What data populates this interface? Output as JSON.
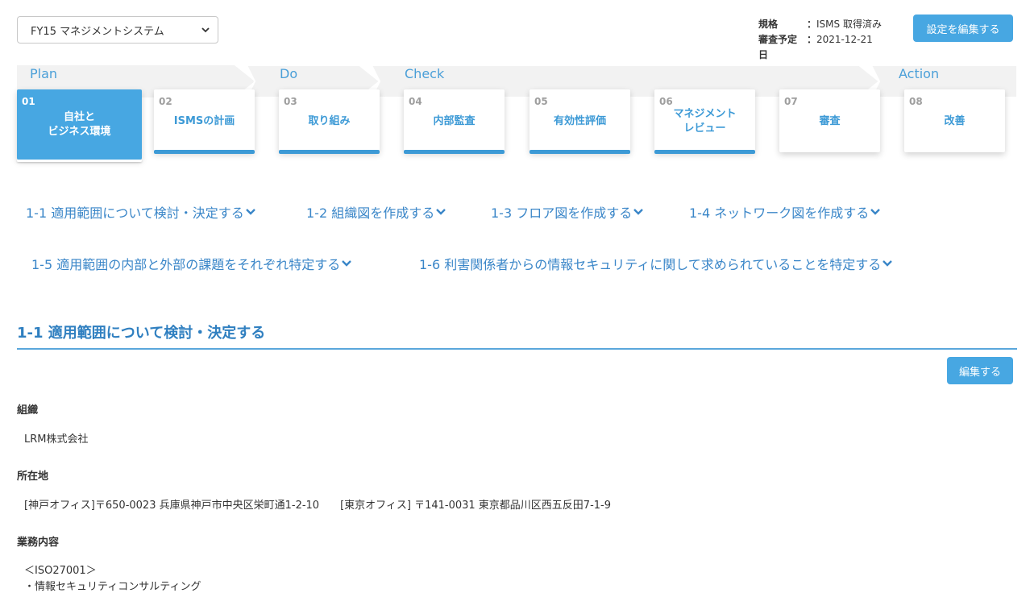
{
  "system_select": {
    "value": "FY15 マネジメントシステム"
  },
  "meta": {
    "standard_label": "規格",
    "standard_value": "ISMS 取得済み",
    "audit_label": "審査予定日",
    "audit_value": "2021-12-21",
    "colon": "："
  },
  "header": {
    "edit_settings_label": "設定を編集する"
  },
  "phases": [
    "Plan",
    "Do",
    "Check",
    "Action"
  ],
  "steps": [
    {
      "num": "01",
      "title": "自社と\nビジネス環境"
    },
    {
      "num": "02",
      "title": "ISMSの計画"
    },
    {
      "num": "03",
      "title": "取り組み"
    },
    {
      "num": "04",
      "title": "内部監査"
    },
    {
      "num": "05",
      "title": "有効性評価"
    },
    {
      "num": "06",
      "title": "マネジメント\nレビュー"
    },
    {
      "num": "07",
      "title": "審査"
    },
    {
      "num": "08",
      "title": "改善"
    }
  ],
  "tasks": [
    "1-1 適用範囲について検討・決定する",
    "1-2 組織図を作成する",
    "1-3 フロア図を作成する",
    "1-4 ネットワーク図を作成する",
    "1-5 適用範囲の内部と外部の課題をそれぞれ特定する",
    "1-6 利害関係者からの情報セキュリティに関して求められていることを特定する"
  ],
  "section": {
    "title": "1-1 適用範囲について検討・決定する",
    "edit_label": "編集する"
  },
  "fields": {
    "org_label": "組織",
    "org_value": "LRM株式会社",
    "address_label": "所在地",
    "address_value": "[神戸オフィス]〒650-0023 兵庫県神戸市中央区栄町通1-2-10　　[東京オフィス] 〒141-0031 東京都品川区西五反田7-1-9",
    "business_label": "業務内容",
    "business_line1": "＜ISO27001＞",
    "business_line2": "・情報セキュリティコンサルティング"
  },
  "colors": {
    "accent": "#47a7e2",
    "link": "#3a86c8",
    "band": "#f2f2f2"
  }
}
